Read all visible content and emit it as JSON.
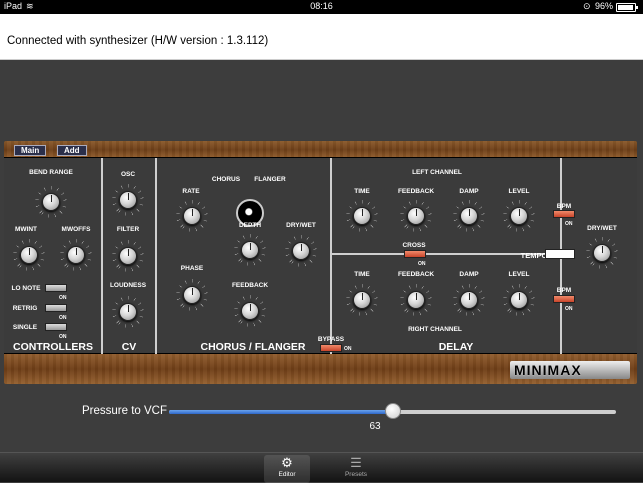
{
  "status_bar": {
    "carrier": "iPad",
    "time": "08:16",
    "battery": "96%"
  },
  "connection_text": "Connected with synthesizer (H/W version : 1.3.112)",
  "panel": {
    "top_buttons": [
      "Main",
      "Add"
    ],
    "sections": {
      "controllers": "CONTROLLERS",
      "cv": "CV",
      "chorus_flanger": "CHORUS / FLANGER",
      "delay": "DELAY"
    },
    "controllers": {
      "bend_range": "BEND RANGE",
      "mwint": "MWINT",
      "mwoffs": "MWOFFS",
      "lo_note": "LO NOTE",
      "retrig": "RETRIG",
      "single": "SINGLE",
      "on": "ON"
    },
    "cv": {
      "osc": "OSC",
      "filter": "FILTER",
      "loudness": "LOUDNESS"
    },
    "chorus": {
      "rate": "RATE",
      "chorus": "CHORUS",
      "flanger": "FLANGER",
      "depth": "DEPTH",
      "dry_wet": "DRY/WET",
      "phase": "PHASE",
      "feedback": "FEEDBACK",
      "bypass": "BYPASS",
      "on": "ON"
    },
    "delay": {
      "left_channel": "LEFT CHANNEL",
      "right_channel": "RIGHT CHANNEL",
      "time": "TIME",
      "feedback": "FEEDBACK",
      "damp": "DAMP",
      "level": "LEVEL",
      "cross": "CROSS",
      "tempo": "TEMPO",
      "bpm": "BPM",
      "dry_wet": "DRY/WET",
      "on": "ON"
    },
    "logo": "MINIMAX"
  },
  "slider": {
    "label": "Pressure to VCF",
    "value": "63",
    "fraction": 0.5
  },
  "tabs": [
    {
      "label": "Editor",
      "icon": "gear-icon"
    },
    {
      "label": "Presets",
      "icon": "list-icon"
    }
  ]
}
